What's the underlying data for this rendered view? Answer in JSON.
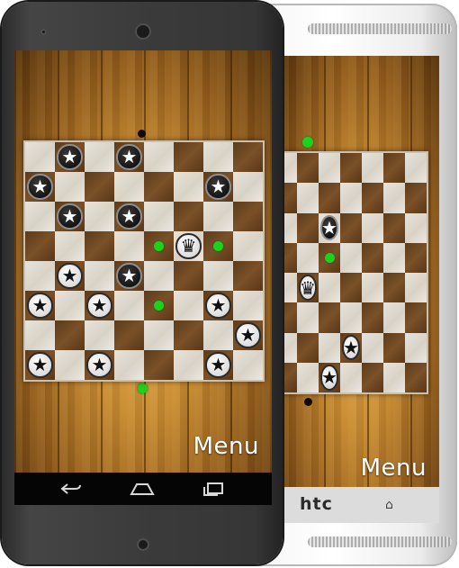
{
  "app": {
    "menu_label": "Menu",
    "brand_back": "htc"
  },
  "colors": {
    "wood_mid": "#c68a32",
    "square_light": "#e8e4dc",
    "square_dark": "#6b4422",
    "move_hint": "#1fd11f",
    "piece_black": "#0a0a0a",
    "piece_white": "#f2f2f2"
  },
  "icons": {
    "man": "star-icon",
    "king": "crown-icon",
    "nav_back": "back-arrow-icon",
    "nav_home": "home-icon",
    "nav_recent": "recent-apps-icon"
  },
  "front_device": {
    "board": {
      "pieces": [
        {
          "row": 0,
          "col": 1,
          "color": "black",
          "kind": "man"
        },
        {
          "row": 0,
          "col": 3,
          "color": "black",
          "kind": "man"
        },
        {
          "row": 1,
          "col": 0,
          "color": "black",
          "kind": "man"
        },
        {
          "row": 1,
          "col": 6,
          "color": "black",
          "kind": "man"
        },
        {
          "row": 2,
          "col": 1,
          "color": "black",
          "kind": "man"
        },
        {
          "row": 2,
          "col": 3,
          "color": "black",
          "kind": "man"
        },
        {
          "row": 3,
          "col": 5,
          "color": "white",
          "kind": "king"
        },
        {
          "row": 4,
          "col": 1,
          "color": "white",
          "kind": "man"
        },
        {
          "row": 4,
          "col": 3,
          "color": "black",
          "kind": "man"
        },
        {
          "row": 5,
          "col": 0,
          "color": "white",
          "kind": "man"
        },
        {
          "row": 5,
          "col": 2,
          "color": "white",
          "kind": "man"
        },
        {
          "row": 5,
          "col": 6,
          "color": "white",
          "kind": "man"
        },
        {
          "row": 6,
          "col": 7,
          "color": "white",
          "kind": "man"
        },
        {
          "row": 7,
          "col": 0,
          "color": "white",
          "kind": "man"
        },
        {
          "row": 7,
          "col": 2,
          "color": "white",
          "kind": "man"
        },
        {
          "row": 7,
          "col": 6,
          "color": "white",
          "kind": "man"
        }
      ],
      "hints": [
        {
          "row": 3,
          "col": 4
        },
        {
          "row": 3,
          "col": 6
        },
        {
          "row": 5,
          "col": 4
        }
      ]
    }
  },
  "back_device": {
    "board": {
      "first_col": 1,
      "pieces": [
        {
          "row": 2,
          "col": 4,
          "color": "black",
          "kind": "man"
        },
        {
          "row": 4,
          "col": 1,
          "color": "white",
          "kind": "man"
        },
        {
          "row": 4,
          "col": 3,
          "color": "white",
          "kind": "king"
        },
        {
          "row": 6,
          "col": 5,
          "color": "white",
          "kind": "man"
        },
        {
          "row": 7,
          "col": 4,
          "color": "white",
          "kind": "man"
        }
      ],
      "hints": [
        {
          "row": 3,
          "col": 4
        }
      ]
    }
  }
}
